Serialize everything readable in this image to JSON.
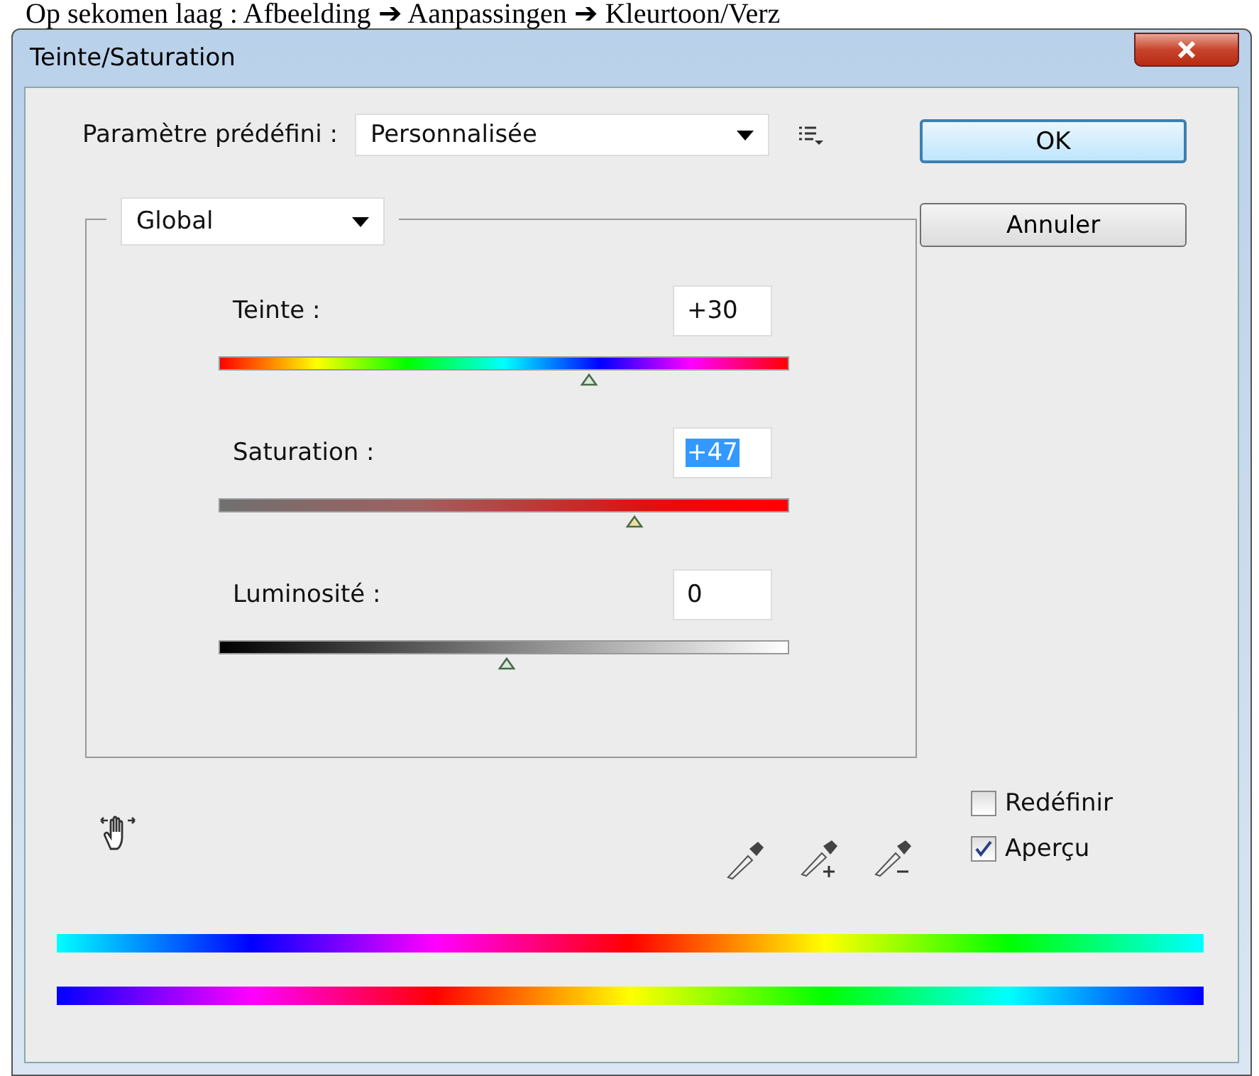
{
  "caption": "Op sekomen laag : Afbeelding ➔ Aanpassingen ➔ Kleurtoon/Verz",
  "window": {
    "title": "Teinte/Saturation"
  },
  "preset": {
    "label": "Paramètre prédéfini :",
    "value": "Personnalisée"
  },
  "buttons": [
    {
      "label": "OK",
      "default": true
    },
    {
      "label": "Annuler",
      "default": false
    }
  ],
  "channel": {
    "value": "Global"
  },
  "sliders": [
    {
      "label": "Teinte :",
      "value": "+30",
      "kind": "hue",
      "level": 0.65,
      "selected": false
    },
    {
      "label": "Saturation :",
      "value": "+47",
      "kind": "saturation",
      "level": 0.73,
      "selected": true
    },
    {
      "label": "Luminosité :",
      "value": "0",
      "kind": "lightness",
      "level": 0.505,
      "selected": false
    }
  ],
  "options": [
    {
      "label": "Redéfinir",
      "checked": false
    },
    {
      "label": "Aperçu",
      "checked": true
    }
  ]
}
